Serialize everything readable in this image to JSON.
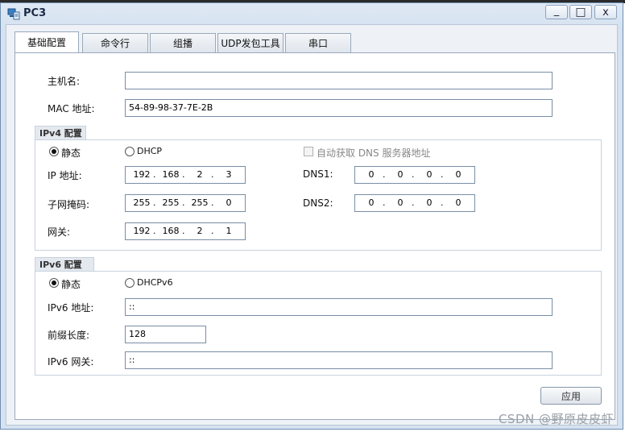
{
  "window": {
    "title": "PC3",
    "minimize": "_",
    "maximize": "□",
    "close": "x"
  },
  "tabs": [
    {
      "label": "基础配置",
      "active": true
    },
    {
      "label": "命令行",
      "active": false
    },
    {
      "label": "组播",
      "active": false
    },
    {
      "label": "UDP发包工具",
      "active": false
    },
    {
      "label": "串口",
      "active": false
    }
  ],
  "basic": {
    "hostname_label": "主机名:",
    "hostname_value": "",
    "mac_label": "MAC 地址:",
    "mac_value": "54-89-98-37-7E-2B"
  },
  "ipv4": {
    "group_title": "IPv4 配置",
    "static_label": "静态",
    "dhcp_label": "DHCP",
    "mode": "static",
    "auto_dns_label": "自动获取 DNS 服务器地址",
    "ip_label": "IP 地址:",
    "ip": [
      "192",
      "168",
      "2",
      "3"
    ],
    "mask_label": "子网掩码:",
    "mask": [
      "255",
      "255",
      "255",
      "0"
    ],
    "gateway_label": "网关:",
    "gateway": [
      "192",
      "168",
      "2",
      "1"
    ],
    "dns1_label": "DNS1:",
    "dns1": [
      "0",
      "0",
      "0",
      "0"
    ],
    "dns2_label": "DNS2:",
    "dns2": [
      "0",
      "0",
      "0",
      "0"
    ]
  },
  "ipv6": {
    "group_title": "IPv6 配置",
    "static_label": "静态",
    "dhcp_label": "DHCPv6",
    "mode": "static",
    "addr_label": "IPv6 地址:",
    "addr_value": "::",
    "prefix_label": "前缀长度:",
    "prefix_value": "128",
    "gateway_label": "IPv6 网关:",
    "gateway_value": "::"
  },
  "apply_label": "应用",
  "watermark": "CSDN @野原皮皮虾"
}
